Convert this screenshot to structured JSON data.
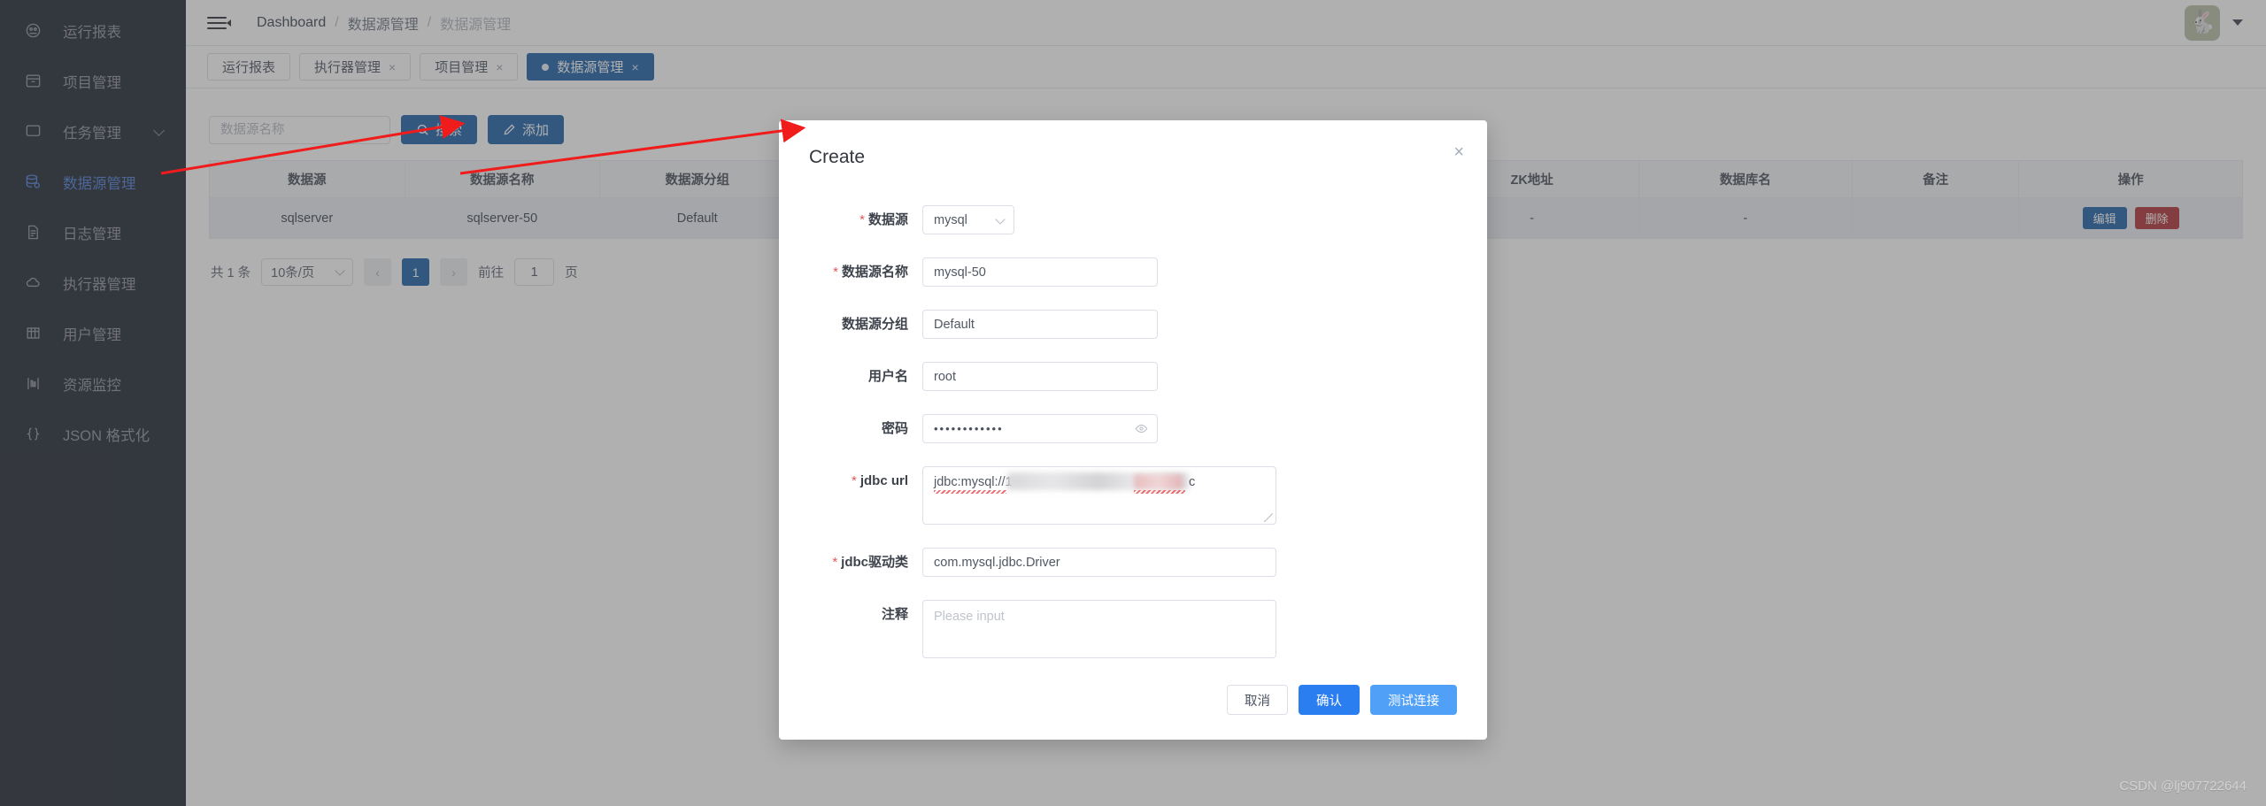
{
  "sidebar": {
    "items": [
      {
        "label": "运行报表",
        "icon": "gauge-icon",
        "active": false,
        "chevron": false
      },
      {
        "label": "项目管理",
        "icon": "archive-icon",
        "active": false,
        "chevron": false
      },
      {
        "label": "任务管理",
        "icon": "monitor-icon",
        "active": false,
        "chevron": true
      },
      {
        "label": "数据源管理",
        "icon": "database-icon",
        "active": true,
        "chevron": false
      },
      {
        "label": "日志管理",
        "icon": "document-icon",
        "active": false,
        "chevron": false
      },
      {
        "label": "执行器管理",
        "icon": "cloud-icon",
        "active": false,
        "chevron": false
      },
      {
        "label": "用户管理",
        "icon": "grid-icon",
        "active": false,
        "chevron": false
      },
      {
        "label": "资源监控",
        "icon": "monitor-chart-icon",
        "active": false,
        "chevron": false
      },
      {
        "label": "JSON 格式化",
        "icon": "braces-icon",
        "active": false,
        "chevron": false
      }
    ]
  },
  "header": {
    "menu_icon": "hamburger-collapse-icon",
    "breadcrumb": [
      {
        "label": "Dashboard",
        "muted": false
      },
      {
        "label": "数据源管理",
        "muted": false
      },
      {
        "label": "数据源管理",
        "muted": true
      }
    ],
    "separator": "/",
    "avatar_icon": "rabbit-avatar",
    "avatar_glyph": "🐇",
    "caret_icon": "chevron-down-icon"
  },
  "tabs": [
    {
      "label": "运行报表",
      "closable": false,
      "active": false
    },
    {
      "label": "执行器管理",
      "closable": true,
      "active": false
    },
    {
      "label": "项目管理",
      "closable": true,
      "active": false
    },
    {
      "label": "数据源管理",
      "closable": true,
      "active": true
    }
  ],
  "tab_close_glyph": "×",
  "toolbar": {
    "search_placeholder": "数据源名称",
    "search_value": "",
    "search_button": "搜索",
    "search_icon": "magnifier-icon",
    "add_button": "添加",
    "add_icon": "pencil-icon"
  },
  "table": {
    "columns": [
      "数据源",
      "数据源名称",
      "数据源分组",
      "",
      "",
      "ZK地址",
      "数据库名",
      "备注",
      "操作"
    ],
    "rows": [
      {
        "cells": [
          "sqlserver",
          "sqlserver-50",
          "Default",
          "",
          "",
          "-",
          "-",
          ""
        ],
        "actions": [
          {
            "label": "编辑",
            "kind": "edit"
          },
          {
            "label": "删除",
            "kind": "delete"
          }
        ]
      }
    ]
  },
  "pagination": {
    "total_text": "共 1 条",
    "page_size": "10条/页",
    "prev_glyph": "‹",
    "next_glyph": "›",
    "pages": [
      "1"
    ],
    "current_page": "1",
    "goto_label": "前往",
    "goto_value": "1",
    "goto_unit": "页"
  },
  "modal": {
    "title": "Create",
    "close_glyph": "×",
    "fields": {
      "datasource": {
        "label": "数据源",
        "required": true,
        "value": "mysql",
        "control": "select"
      },
      "datasource_name": {
        "label": "数据源名称",
        "required": true,
        "value": "mysql-50",
        "control": "input"
      },
      "datasource_group": {
        "label": "数据源分组",
        "required": false,
        "value": "Default",
        "control": "input"
      },
      "username": {
        "label": "用户名",
        "required": false,
        "value": "root",
        "control": "input"
      },
      "password": {
        "label": "密码",
        "required": false,
        "value": "••••••••••••",
        "control": "password",
        "eye_icon": "eye-icon"
      },
      "jdbc_url": {
        "label": "jdbc url",
        "required": true,
        "value": "jdbc:mysql://1",
        "value_tail": "c",
        "control": "textarea"
      },
      "jdbc_driver": {
        "label": "jdbc驱动类",
        "required": true,
        "value": "com.mysql.jdbc.Driver",
        "control": "input"
      },
      "comment": {
        "label": "注释",
        "required": false,
        "value": "",
        "placeholder": "Please input",
        "control": "textarea"
      }
    },
    "required_marker": "*",
    "buttons": {
      "cancel": "取消",
      "confirm": "确认",
      "test": "测试连接"
    }
  },
  "annotations": {
    "arrow_color": "#f01c1c",
    "arrows": 2
  },
  "watermark": "CSDN @lj907722644",
  "colors": {
    "sidebar_bg": "#1d2330",
    "accent_blue": "#1b5fa8",
    "primary_blue": "#2a7ef0",
    "light_blue": "#50a0f7",
    "danger_red": "#b02f33",
    "required_red": "#e2575c",
    "active_link": "#4b7bd1"
  }
}
